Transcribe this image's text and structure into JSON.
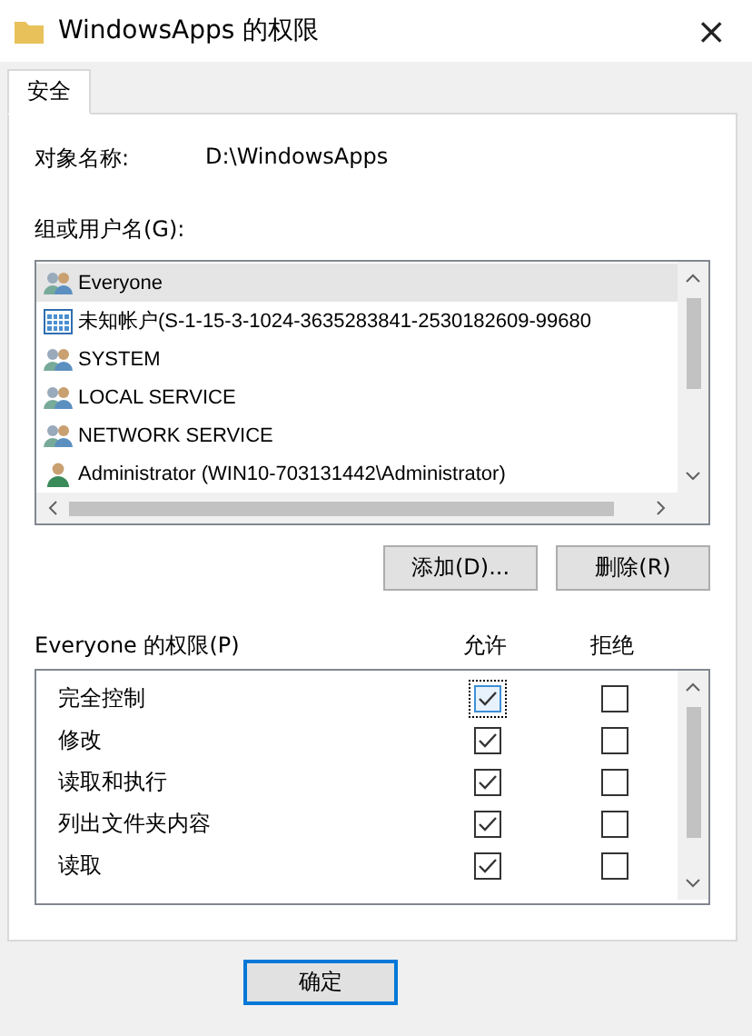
{
  "window": {
    "title": "WindowsApps 的权限",
    "close": "×"
  },
  "tabs": [
    {
      "label": "安全",
      "selected": true
    }
  ],
  "object": {
    "label": "对象名称:",
    "value": "D:\\WindowsApps"
  },
  "users": {
    "label": "组或用户名(G):",
    "items": [
      {
        "name": "Everyone",
        "kind": "group",
        "selected": true
      },
      {
        "name": "未知帐户(S-1-15-3-1024-3635283841-2530182609-99680",
        "kind": "unknown",
        "selected": false
      },
      {
        "name": "SYSTEM",
        "kind": "group",
        "selected": false
      },
      {
        "name": "LOCAL SERVICE",
        "kind": "group",
        "selected": false
      },
      {
        "name": "NETWORK SERVICE",
        "kind": "group",
        "selected": false
      },
      {
        "name": "Administrator (WIN10-703131442\\Administrator)",
        "kind": "user",
        "selected": false
      }
    ]
  },
  "user_buttons": [
    "添加(D)...",
    "删除(R)"
  ],
  "permissions": {
    "label": "Everyone 的权限(P)",
    "allow_header": "允许",
    "deny_header": "拒绝",
    "rows": [
      {
        "name": "完全控制",
        "allow": true,
        "deny": false,
        "focused": true
      },
      {
        "name": "修改",
        "allow": true,
        "deny": false,
        "focused": false
      },
      {
        "name": "读取和执行",
        "allow": true,
        "deny": false,
        "focused": false
      },
      {
        "name": "列出文件夹内容",
        "allow": true,
        "deny": false,
        "focused": false
      },
      {
        "name": "读取",
        "allow": true,
        "deny": false,
        "focused": false
      }
    ]
  },
  "footer_buttons": [
    {
      "label": "确定",
      "default": true
    }
  ]
}
